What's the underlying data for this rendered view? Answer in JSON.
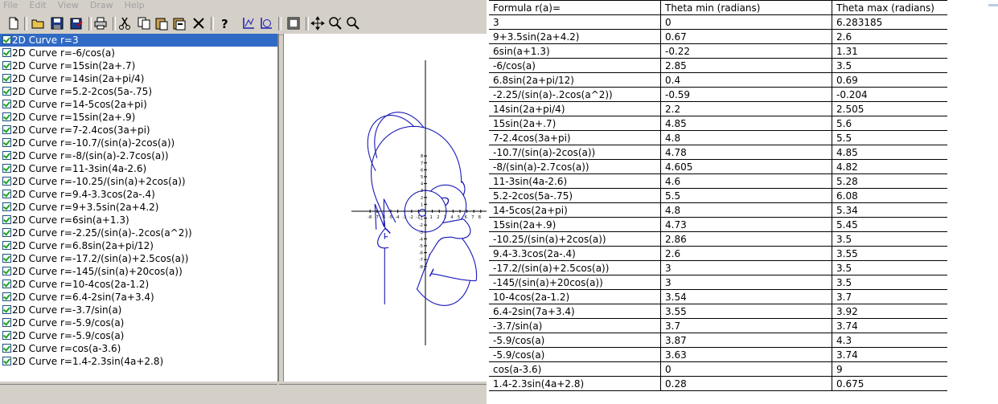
{
  "menu": [
    "File",
    "Edit",
    "View",
    "Draw",
    "Help"
  ],
  "toolbar": {
    "icons": [
      "new-icon",
      "open-icon",
      "save-icon",
      "save-as-icon",
      "print-icon",
      "cut-icon",
      "copy-icon",
      "paste-icon",
      "paste-special-icon",
      "delete-icon",
      "help-icon",
      "axes-icon",
      "grid-icon",
      "window-icon",
      "move-icon",
      "zoom-icon",
      "zoom-out-icon"
    ]
  },
  "curve_list": {
    "prefix": "2D Curve",
    "items": [
      "r=3",
      "r=-6/cos(a)",
      "r=15sin(2a+.7)",
      "r=14sin(2a+pi/4)",
      "r=5.2-2cos(5a-.75)",
      "r=14-5cos(2a+pi)",
      "r=15sin(2a+.9)",
      "r=7-2.4cos(3a+pi)",
      "r=-10.7/(sin(a)-2cos(a))",
      "r=-8/(sin(a)-2.7cos(a))",
      "r=11-3sin(4a-2.6)",
      "r=-10.25/(sin(a)+2cos(a))",
      "r=9.4-3.3cos(2a-.4)",
      "r=9+3.5sin(2a+4.2)",
      "r=6sin(a+1.3)",
      "r=-2.25/(sin(a)-.2cos(a^2))",
      "r=6.8sin(2a+pi/12)",
      "r=-17.2/(sin(a)+2.5cos(a))",
      "r=-145/(sin(a)+20cos(a))",
      "r=10-4cos(2a-1.2)",
      "r=6.4-2sin(7a+3.4)",
      "r=-3.7/sin(a)",
      "r=-5.9/cos(a)",
      "r=-5.9/cos(a)",
      "r=cos(a-3.6)",
      "r=1.4-2.3sin(4a+2.8)"
    ],
    "selected_index": 0
  },
  "plot": {
    "x_ticks": [
      "-8",
      "-7",
      "-6",
      "-5",
      "-4",
      "-3",
      "-2",
      "-1",
      "1",
      "2",
      "3",
      "4",
      "5",
      "6",
      "7",
      "8"
    ],
    "y_ticks_pos": [
      "8",
      "7",
      "6",
      "5",
      "4",
      "3",
      "2",
      "1"
    ],
    "y_ticks_neg": [
      "-1",
      "-2",
      "-3",
      "-4",
      "-5",
      "-6",
      "-7",
      "-8"
    ],
    "curve_color": "#1a1ab8"
  },
  "table": {
    "headers": [
      "Formula r(a)=",
      "Theta min (radians)",
      "Theta max (radians)"
    ],
    "rows": [
      [
        "3",
        "0",
        "6.283185"
      ],
      [
        "9+3.5sin(2a+4.2)",
        "0.67",
        "2.6"
      ],
      [
        "6sin(a+1.3)",
        "-0.22",
        "1.31"
      ],
      [
        "-6/cos(a)",
        "2.85",
        "3.5"
      ],
      [
        "6.8sin(2a+pi/12)",
        "0.4",
        "0.69"
      ],
      [
        "-2.25/(sin(a)-.2cos(a^2))",
        "-0.59",
        "-0.204"
      ],
      [
        "14sin(2a+pi/4)",
        "2.2",
        "2.505"
      ],
      [
        "15sin(2a+.7)",
        "4.85",
        "5.6"
      ],
      [
        "7-2.4cos(3a+pi)",
        "4.8",
        "5.5"
      ],
      [
        "-10.7/(sin(a)-2cos(a))",
        "4.78",
        "4.85"
      ],
      [
        "-8/(sin(a)-2.7cos(a))",
        "4.605",
        "4.82"
      ],
      [
        "11-3sin(4a-2.6)",
        "4.6",
        "5.28"
      ],
      [
        "5.2-2cos(5a-.75)",
        "5.5",
        "6.08"
      ],
      [
        "14-5cos(2a+pi)",
        "4.8",
        "5.34"
      ],
      [
        "15sin(2a+.9)",
        "4.73",
        "5.45"
      ],
      [
        "-10.25/(sin(a)+2cos(a))",
        "2.86",
        "3.5"
      ],
      [
        "9.4-3.3cos(2a-.4)",
        "2.6",
        "3.55"
      ],
      [
        "-17.2/(sin(a)+2.5cos(a))",
        "3",
        "3.5"
      ],
      [
        "-145/(sin(a)+20cos(a))",
        "3",
        "3.5"
      ],
      [
        "10-4cos(2a-1.2)",
        "3.54",
        "3.7"
      ],
      [
        "6.4-2sin(7a+3.4)",
        "3.55",
        "3.92"
      ],
      [
        "-3.7/sin(a)",
        "3.7",
        "3.74"
      ],
      [
        "-5.9/cos(a)",
        "3.87",
        "4.3"
      ],
      [
        "-5.9/cos(a)",
        "3.63",
        "3.74"
      ],
      [
        "cos(a-3.6)",
        "0",
        "9"
      ],
      [
        "1.4-2.3sin(4a+2.8)",
        "0.28",
        "0.675"
      ]
    ]
  }
}
